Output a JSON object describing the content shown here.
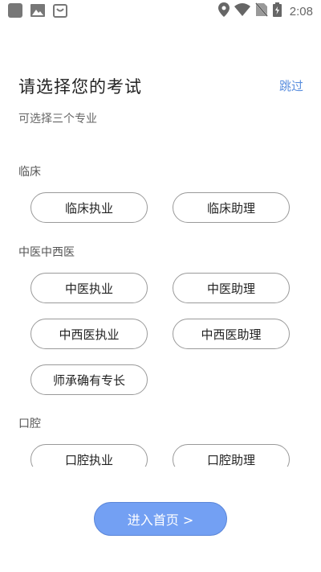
{
  "status_bar": {
    "time": "2:08",
    "icons_left": [
      "app-icon",
      "image-icon",
      "shop-icon"
    ],
    "icons_right": [
      "location-icon",
      "wifi-icon",
      "no-sim-icon",
      "battery-icon"
    ]
  },
  "header": {
    "title": "请选择您的考试",
    "skip_label": "跳过",
    "subtitle": "可选择三个专业"
  },
  "sections": [
    {
      "label": "临床",
      "options": [
        "临床执业",
        "临床助理"
      ]
    },
    {
      "label": "中医中西医",
      "options": [
        "中医执业",
        "中医助理",
        "中西医执业",
        "中西医助理",
        "师承确有专长"
      ]
    },
    {
      "label": "口腔",
      "options": [
        "口腔执业",
        "口腔助理"
      ]
    }
  ],
  "enter_button": {
    "label": "进入首页 >"
  },
  "colors": {
    "accent": "#73a0f3",
    "skip_link": "#5b8fde",
    "pill_border": "#9a9a9a"
  }
}
